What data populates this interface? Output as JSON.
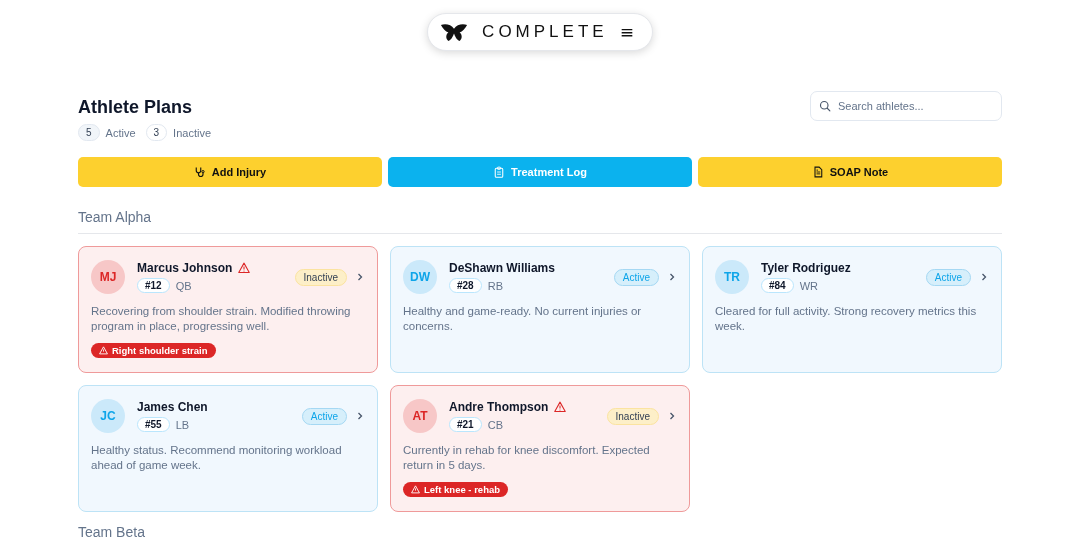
{
  "header": {
    "brand": "COMPLETE",
    "menu_icon": "≡"
  },
  "title": "Athlete Plans",
  "counts": [
    {
      "count": "5",
      "label": "Active",
      "selected": true
    },
    {
      "count": "3",
      "label": "Inactive",
      "selected": false
    }
  ],
  "search": {
    "placeholder": "Search athletes..."
  },
  "actions": [
    {
      "label": "Add Injury",
      "kind": "injury"
    },
    {
      "label": "Treatment Log",
      "kind": "log"
    },
    {
      "label": "SOAP Note",
      "kind": "note"
    }
  ],
  "teams": [
    {
      "name": "Team Alpha",
      "athletes": [
        {
          "initials": "MJ",
          "name": "Marcus Johnson",
          "alert": true,
          "number": "#12",
          "position": "QB",
          "status": "Inactive",
          "active": false,
          "note": "Recovering from shoulder strain. Modified throwing program in place, progressing well.",
          "injury": "Right shoulder strain"
        },
        {
          "initials": "DW",
          "name": "DeShawn Williams",
          "alert": false,
          "number": "#28",
          "position": "RB",
          "status": "Active",
          "active": true,
          "note": "Healthy and game-ready. No current injuries or concerns."
        },
        {
          "initials": "TR",
          "name": "Tyler Rodriguez",
          "alert": false,
          "number": "#84",
          "position": "WR",
          "status": "Active",
          "active": true,
          "note": "Cleared for full activity. Strong recovery metrics this week."
        },
        {
          "initials": "JC",
          "name": "James Chen",
          "alert": false,
          "number": "#55",
          "position": "LB",
          "status": "Active",
          "active": true,
          "note": "Healthy status. Recommend monitoring workload ahead of game week."
        },
        {
          "initials": "AT",
          "name": "Andre Thompson",
          "alert": true,
          "number": "#21",
          "position": "CB",
          "status": "Inactive",
          "active": false,
          "note": "Currently in rehab for knee discomfort. Expected return in 5 days.",
          "injury": "Left knee - rehab"
        }
      ]
    },
    {
      "name": "Team Beta"
    }
  ]
}
